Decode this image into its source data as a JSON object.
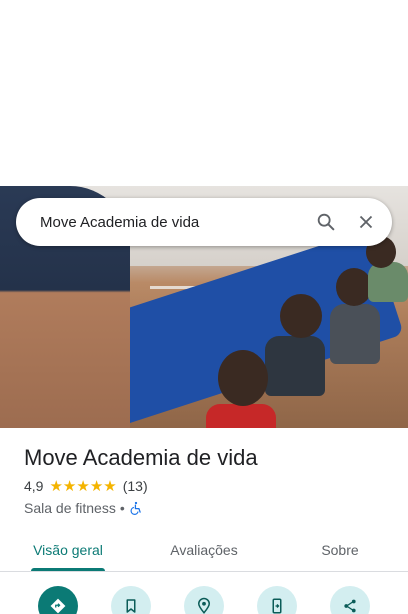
{
  "search": {
    "query": "Move Academia de vida"
  },
  "place": {
    "name": "Move Academia de vida",
    "rating": "4,9",
    "stars": 5,
    "review_count": "(13)",
    "category": "Sala de fitness",
    "separator": "•"
  },
  "tabs": [
    {
      "label": "Visão geral",
      "active": true
    },
    {
      "label": "Avaliações",
      "active": false
    },
    {
      "label": "Sobre",
      "active": false
    }
  ],
  "actions": [
    {
      "icon": "directions-icon"
    },
    {
      "icon": "bookmark-icon"
    },
    {
      "icon": "location-pin-icon"
    },
    {
      "icon": "send-to-phone-icon"
    },
    {
      "icon": "share-icon"
    }
  ],
  "colors": {
    "accent": "#0b7a75",
    "star": "#f4b400",
    "action_bg": "#d3eef0"
  }
}
